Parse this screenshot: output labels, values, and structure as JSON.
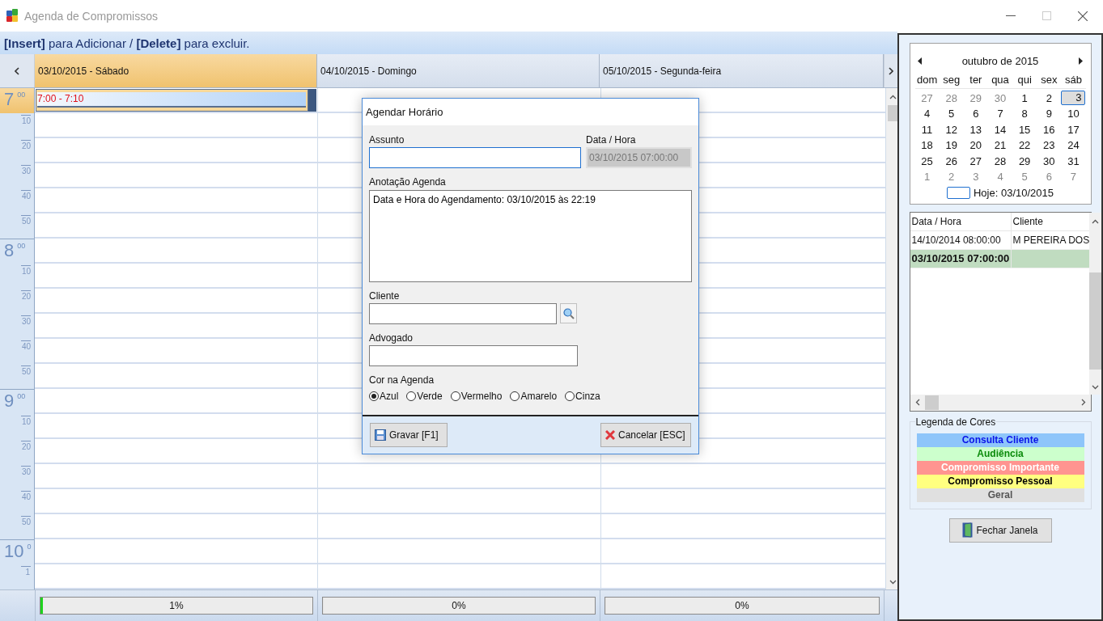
{
  "window": {
    "title": "Agenda de Compromissos"
  },
  "hint": "**[Insert]** para Adicionar / **[Delete]** para excluir.",
  "days": [
    {
      "label": "03/10/2015 - Sábado",
      "selected": true,
      "events": [
        {
          "label": "7:00 - 7:10",
          "selected": true
        }
      ],
      "progress": {
        "level": 0.01,
        "reading": "1%"
      }
    },
    {
      "label": "04/10/2015 - Domingo",
      "selected": false,
      "progress": {
        "level": 0,
        "reading": "0%"
      }
    },
    {
      "label": "05/10/2015 - Segunda-feira",
      "selected": false,
      "progress": {
        "level": 0,
        "reading": "0%"
      }
    }
  ],
  "time_rows": [
    {
      "kind": "hour",
      "label": "7",
      "minutes": "00",
      "selected": true
    },
    {
      "kind": "minute",
      "label": "10"
    },
    {
      "kind": "minute",
      "label": "20"
    },
    {
      "kind": "minute",
      "label": "30"
    },
    {
      "kind": "minute",
      "label": "40"
    },
    {
      "kind": "minute",
      "label": "50"
    },
    {
      "kind": "hour",
      "label": "8",
      "minutes": "00",
      "selected": false
    },
    {
      "kind": "minute",
      "label": "10"
    },
    {
      "kind": "minute",
      "label": "20"
    },
    {
      "kind": "minute",
      "label": "30"
    },
    {
      "kind": "minute",
      "label": "40"
    },
    {
      "kind": "minute",
      "label": "50"
    },
    {
      "kind": "hour",
      "label": "9",
      "minutes": "00",
      "selected": false
    },
    {
      "kind": "minute",
      "label": "10"
    },
    {
      "kind": "minute",
      "label": "20"
    },
    {
      "kind": "minute",
      "label": "30"
    },
    {
      "kind": "minute",
      "label": "40"
    },
    {
      "kind": "minute",
      "label": "50"
    },
    {
      "kind": "hour",
      "label": "10",
      "minutes": "0",
      "selected": false
    },
    {
      "kind": "minute",
      "label": "1"
    }
  ],
  "dialog": {
    "title": "Agendar Horário",
    "assunto": {
      "label": "Assunto"
    },
    "data_hora": {
      "label": "Data / Hora",
      "value": "03/10/2015 07:00:00",
      "disabled": true
    },
    "anotacao": {
      "label": "Anotação Agenda",
      "value": "Data e Hora do Agendamento: 03/10/2015 às 22:19"
    },
    "cliente": {
      "label": "Cliente"
    },
    "advogado": {
      "label": "Advogado"
    },
    "cor": {
      "label": "Cor na Agenda",
      "options": [
        {
          "label": "Azul",
          "selected": true
        },
        {
          "label": "Verde",
          "selected": false
        },
        {
          "label": "Vermelho",
          "selected": false
        },
        {
          "label": "Amarelo",
          "selected": false
        },
        {
          "label": "Cinza",
          "selected": false
        }
      ]
    },
    "buttons": [
      {
        "kind": "save",
        "label": "Gravar [F1]"
      },
      {
        "kind": "cancel",
        "label": "Cancelar [ESC]"
      }
    ]
  },
  "calendar": {
    "month": "outubro de 2015",
    "weekdays": [
      "dom",
      "seg",
      "ter",
      "qua",
      "qui",
      "sex",
      "sáb"
    ],
    "weeks": [
      [
        {
          "d": "27",
          "other": true,
          "selected": false
        },
        {
          "d": "28",
          "other": true,
          "selected": false
        },
        {
          "d": "29",
          "other": true,
          "selected": false
        },
        {
          "d": "30",
          "other": true,
          "selected": false
        },
        {
          "d": "1",
          "other": false,
          "selected": false
        },
        {
          "d": "2",
          "other": false,
          "selected": false
        },
        {
          "d": "3",
          "other": false,
          "selected": true
        }
      ],
      [
        {
          "d": "4",
          "other": false,
          "selected": false
        },
        {
          "d": "5",
          "other": false,
          "selected": false
        },
        {
          "d": "6",
          "other": false,
          "selected": false
        },
        {
          "d": "7",
          "other": false,
          "selected": false
        },
        {
          "d": "8",
          "other": false,
          "selected": false
        },
        {
          "d": "9",
          "other": false,
          "selected": false
        },
        {
          "d": "10",
          "other": false,
          "selected": false
        }
      ],
      [
        {
          "d": "11",
          "other": false,
          "selected": false
        },
        {
          "d": "12",
          "other": false,
          "selected": false
        },
        {
          "d": "13",
          "other": false,
          "selected": false
        },
        {
          "d": "14",
          "other": false,
          "selected": false
        },
        {
          "d": "15",
          "other": false,
          "selected": false
        },
        {
          "d": "16",
          "other": false,
          "selected": false
        },
        {
          "d": "17",
          "other": false,
          "selected": false
        }
      ],
      [
        {
          "d": "18",
          "other": false,
          "selected": false
        },
        {
          "d": "19",
          "other": false,
          "selected": false
        },
        {
          "d": "20",
          "other": false,
          "selected": false
        },
        {
          "d": "21",
          "other": false,
          "selected": false
        },
        {
          "d": "22",
          "other": false,
          "selected": false
        },
        {
          "d": "23",
          "other": false,
          "selected": false
        },
        {
          "d": "24",
          "other": false,
          "selected": false
        }
      ],
      [
        {
          "d": "25",
          "other": false,
          "selected": false
        },
        {
          "d": "26",
          "other": false,
          "selected": false
        },
        {
          "d": "27",
          "other": false,
          "selected": false
        },
        {
          "d": "28",
          "other": false,
          "selected": false
        },
        {
          "d": "29",
          "other": false,
          "selected": false
        },
        {
          "d": "30",
          "other": false,
          "selected": false
        },
        {
          "d": "31",
          "other": false,
          "selected": false
        }
      ],
      [
        {
          "d": "1",
          "other": true,
          "selected": false
        },
        {
          "d": "2",
          "other": true,
          "selected": false
        },
        {
          "d": "3",
          "other": true,
          "selected": false
        },
        {
          "d": "4",
          "other": true,
          "selected": false
        },
        {
          "d": "5",
          "other": true,
          "selected": false
        },
        {
          "d": "6",
          "other": true,
          "selected": false
        },
        {
          "d": "7",
          "other": true,
          "selected": false
        }
      ]
    ],
    "today": "Hoje: 03/10/2015"
  },
  "appointments": {
    "columns": [
      "Data / Hora",
      "Cliente"
    ],
    "rows": [
      {
        "cells": [
          "14/10/2014 08:00:00",
          "M PEREIRA DOS"
        ],
        "selected": false
      },
      {
        "cells": [
          "03/10/2015 07:00:00"
        ],
        "selected": true
      }
    ]
  },
  "legend": {
    "title": "Legenda de Cores",
    "items": [
      {
        "label": "Consulta Cliente",
        "color": "#8ec5fa"
      },
      {
        "label": "Audiência",
        "color": "#ccffcc"
      },
      {
        "label": "Compromisso Importante",
        "color": "#ff9490"
      },
      {
        "label": "Compromisso Pessoal",
        "color": "#ffff80"
      },
      {
        "label": "Geral",
        "color": "#e0e0e0"
      }
    ]
  },
  "close_button": "Fechar Janela"
}
